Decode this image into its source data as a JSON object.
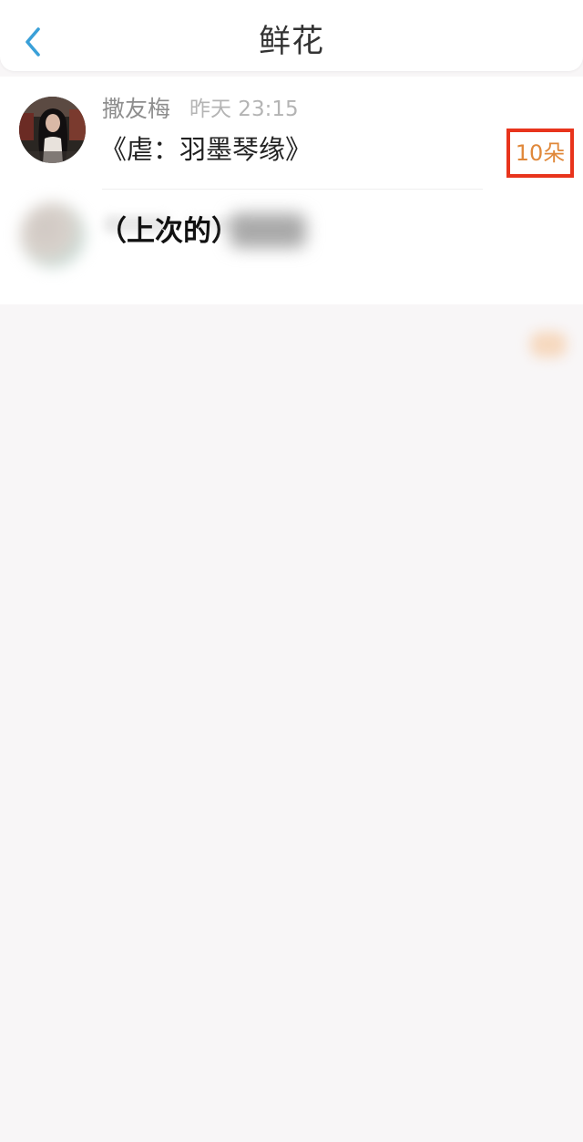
{
  "header": {
    "title": "鲜花",
    "back_icon": "chevron-left-icon",
    "accent_color": "#3aa0d8"
  },
  "items": [
    {
      "name": "撒友梅",
      "time": "昨天 23:15",
      "content": "《虐：羽墨琴缘》",
      "flowers": "10朵",
      "flower_color": "#e0883a",
      "highlight_color": "#e8341c"
    },
    {
      "content": "（上次的）"
    }
  ]
}
